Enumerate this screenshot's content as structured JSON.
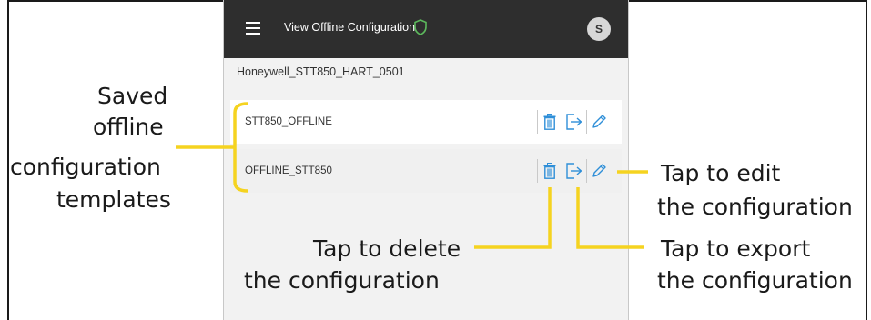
{
  "app": {
    "title": "View Offline Configuration",
    "avatar_initial": "S",
    "device_name": "Honeywell_STT850_HART_0501"
  },
  "icons": {
    "menu": "hamburger-menu-icon",
    "shield": "shield-icon",
    "delete": "trash-icon",
    "export": "export-icon",
    "edit": "pencil-icon"
  },
  "configurations": [
    {
      "name": "STT850_OFFLINE"
    },
    {
      "name": "OFFLINE_STT850"
    }
  ],
  "annotations": {
    "saved_templates": [
      "Saved",
      "offline",
      "configuration",
      "templates"
    ],
    "delete": [
      "Tap to delete",
      "the configuration"
    ],
    "edit": [
      "Tap to edit",
      "the configuration"
    ],
    "export": [
      "Tap to export",
      "the configuration"
    ]
  },
  "colors": {
    "appbar": "#2e2e2e",
    "accent_icon": "#2f8fd8",
    "shield": "#5cb85c",
    "callout": "#f5d320"
  }
}
